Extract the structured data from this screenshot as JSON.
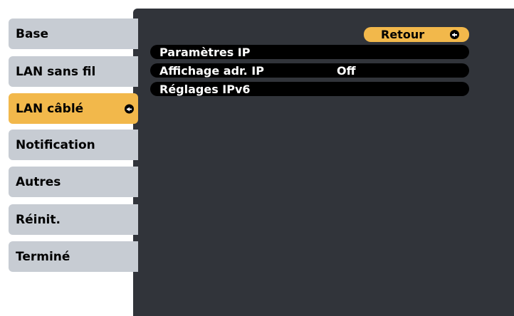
{
  "sidebar": {
    "items": [
      {
        "label": "Base"
      },
      {
        "label": "LAN sans fil"
      },
      {
        "label": "LAN câblé"
      },
      {
        "label": "Notification"
      },
      {
        "label": "Autres"
      },
      {
        "label": "Réinit."
      },
      {
        "label": "Terminé"
      }
    ],
    "active_index": 2
  },
  "panel": {
    "back_label": "Retour",
    "rows": [
      {
        "label": "Paramètres IP",
        "value": ""
      },
      {
        "label": "Affichage adr. IP",
        "value": "Off"
      },
      {
        "label": "Réglages IPv6",
        "value": ""
      }
    ]
  },
  "icons": {
    "enter": "enter-icon"
  },
  "colors": {
    "accent": "#f2b84b",
    "menu_bg": "#c7ccd3",
    "panel_bg": "#31343a",
    "row_bg": "#000000"
  }
}
